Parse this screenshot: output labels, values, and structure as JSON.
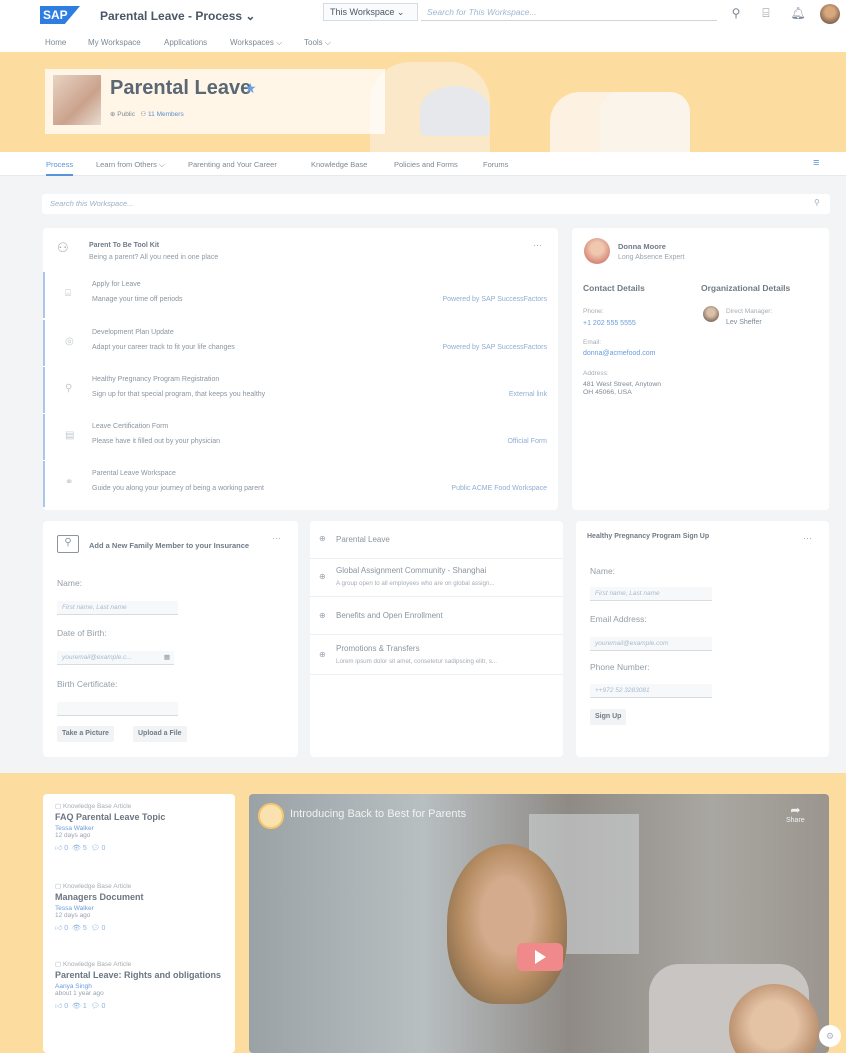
{
  "header": {
    "logo": "SAP",
    "app_title": "Parental Leave - Process ⌄",
    "scope": "This Workspace",
    "search_placeholder": "Search for This Workspace..."
  },
  "nav": {
    "items": [
      "Home",
      "My Workspace",
      "Applications",
      "Workspaces ⌵",
      "Tools ⌵"
    ]
  },
  "workspace": {
    "title": "Parental Leave",
    "visibility": "Public",
    "members": "11 Members"
  },
  "tabs": [
    "Process",
    "Learn from Others ⌵",
    "Parenting and Your Career",
    "Knowledge Base",
    "Policies and Forms",
    "Forums"
  ],
  "workspace_search_placeholder": "Search this Workspace...",
  "toolkit": {
    "title": "Parent To Be Tool Kit",
    "subtitle": "Being a parent? All you need in one place",
    "more": "···",
    "items": [
      {
        "title": "Apply for Leave",
        "desc": "Manage your time off periods",
        "right": "Powered by SAP SuccessFactors"
      },
      {
        "title": "Development Plan Update",
        "desc": "Adapt your career track to fit your life changes",
        "right": "Powered by SAP SuccessFactors"
      },
      {
        "title": "Healthy Pregnancy Program Registration",
        "desc": "Sign up for that special program, that keeps you healthy",
        "right": "External link"
      },
      {
        "title": "Leave Certification Form",
        "desc": "Please have it filled out by your physician",
        "right": "Official Form"
      },
      {
        "title": "Parental Leave Workspace",
        "desc": "Guide you along your journey of being a working parent",
        "right": "Public ACME Food Workspace"
      }
    ]
  },
  "contact": {
    "name": "Donna Moore",
    "role": "Long Absence Expert",
    "contact_heading": "Contact Details",
    "org_heading": "Organizational Details",
    "phone_label": "Phone:",
    "phone": "+1 202 555 5555",
    "email_label": "Email:",
    "email": "donna@acmefood.com",
    "address_label": "Address:",
    "address1": "481 West Street, Anytown",
    "address2": "OH 45066, USA",
    "manager_label": "Direct Manager:",
    "manager": "Lev Sheffer"
  },
  "family": {
    "title": "Add a New Family Member to your Insurance",
    "more": "···",
    "name_label": "Name:",
    "name_placeholder": "First name, Last name",
    "dob_label": "Date of Birth:",
    "dob_placeholder": "youremail@example.c...",
    "cert_label": "Birth Certificate:",
    "btn_picture": "Take a Picture",
    "btn_upload": "Upload a File"
  },
  "parental_list": {
    "items": [
      {
        "title": "Parental Leave",
        "desc": ""
      },
      {
        "title": "Global Assignment Community - Shanghai",
        "desc": "A group open to all employees who are on global assign..."
      },
      {
        "title": "Benefits and Open Enrollment",
        "desc": ""
      },
      {
        "title": "Promotions & Transfers",
        "desc": "Lorem ipsum dolor sit amet, consetetur sadipscing elitr, s..."
      }
    ]
  },
  "pregnancy": {
    "title": "Healthy Pregnancy Program Sign Up",
    "more": "···",
    "name_label": "Name:",
    "name_placeholder": "First name, Last name",
    "email_label": "Email Address:",
    "email_placeholder": "youremail@example.com",
    "phone_label": "Phone Number:",
    "phone_placeholder": "++972 52 3283081",
    "btn": "Sign Up"
  },
  "kb": {
    "items": [
      {
        "kind": "Knowledge Base Article",
        "title": "FAQ Parental Leave Topic",
        "author": "Tessa Walker",
        "ago": "12 days ago",
        "stats": "0   5   0"
      },
      {
        "kind": "Knowledge Base Article",
        "title": "Managers Document",
        "author": "Tessa Walker",
        "ago": "12 days ago",
        "stats": "0   5   0"
      },
      {
        "kind": "Knowledge Base Article",
        "title": "Parental Leave: Rights and obligations",
        "author": "Aanya Singh",
        "ago": "about 1 year ago",
        "stats": "0   1   0"
      }
    ]
  },
  "video": {
    "title": "Introducing Back to Best for Parents",
    "share": "Share"
  }
}
